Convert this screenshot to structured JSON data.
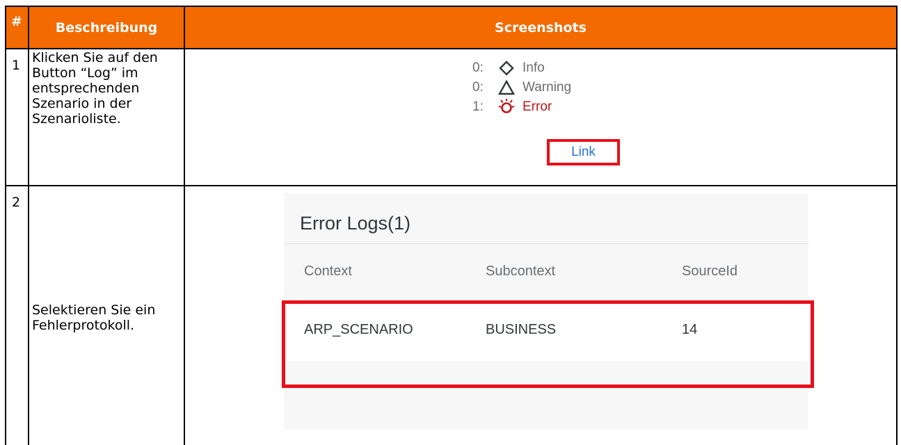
{
  "table": {
    "headers": {
      "num": "#",
      "description": "Beschreibung",
      "screenshots": "Screenshots"
    },
    "rows": [
      {
        "num": "1",
        "description": "Klicken Sie auf den Button “Log” im entsprechenden Szenario in der Szenarioliste."
      },
      {
        "num": "2",
        "description": "Selektieren Sie ein Fehlerprotokoll."
      }
    ]
  },
  "status": {
    "info": {
      "count": "0:",
      "label": "Info",
      "icon": "diamond-icon"
    },
    "warning": {
      "count": "0:",
      "label": "Warning",
      "icon": "triangle-icon"
    },
    "error": {
      "count": "1:",
      "label": "Error",
      "icon": "error-burst-icon"
    },
    "link": "Link"
  },
  "error_log": {
    "title": "Error Logs(1)",
    "columns": [
      "Context",
      "Subcontext",
      "SourceId"
    ],
    "rows": [
      [
        "ARP_SCENARIO",
        "BUSINESS",
        "14"
      ]
    ]
  },
  "colors": {
    "header_bg": "#f36a00",
    "highlight": "#e8101a",
    "error_text": "#c0161b",
    "link_text": "#2a72d4"
  }
}
